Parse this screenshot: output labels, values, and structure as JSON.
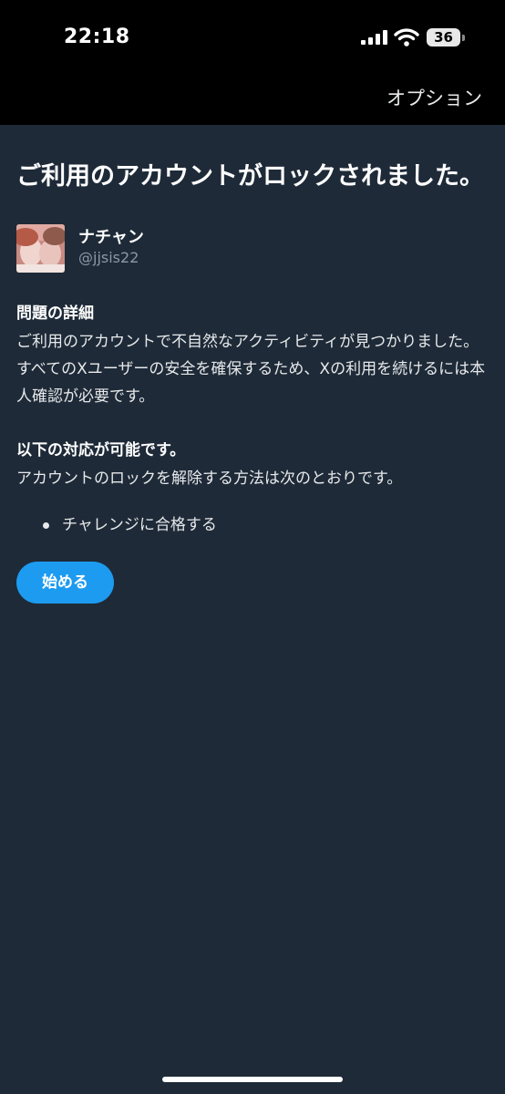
{
  "status_bar": {
    "time": "22:18",
    "battery": "36",
    "icons": [
      "signal-icon",
      "wifi-icon",
      "battery-icon"
    ]
  },
  "header": {
    "options_label": "オプション"
  },
  "main": {
    "title": "ご利用のアカウントがロックされました。",
    "profile": {
      "name": "ナチャン",
      "handle": "@jjsis22"
    },
    "details": {
      "heading": "問題の詳細",
      "body": "ご利用のアカウントで不自然なアクティビティが見つかりました。すべてのXユーザーの安全を確保するため、Xの利用を続けるには本人確認が必要です。"
    },
    "actions": {
      "heading": "以下の対応が可能です。",
      "body": "アカウントのロックを解除する方法は次のとおりです。",
      "items": [
        "チャレンジに合格する"
      ]
    },
    "start_button": "始める"
  },
  "colors": {
    "background": "#1e2a38",
    "top_bar": "#000000",
    "accent": "#1d9bf0",
    "secondary_text": "#8b98a5"
  }
}
